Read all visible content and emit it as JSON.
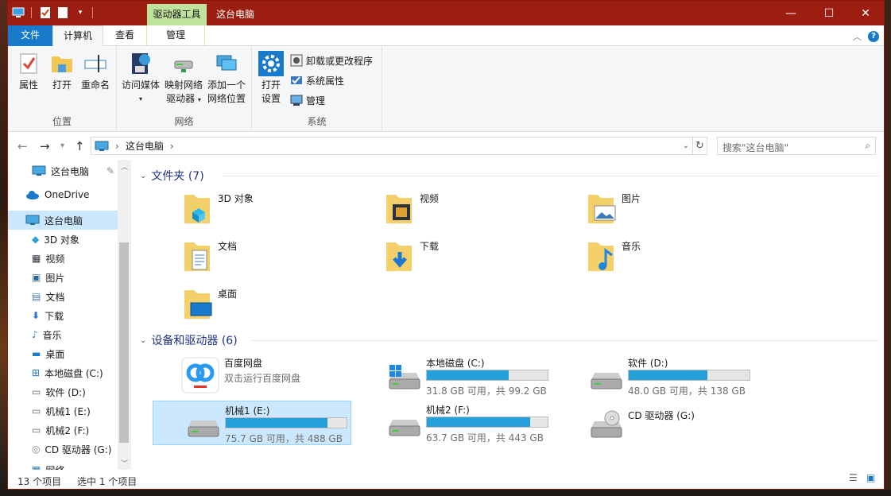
{
  "titlebar": {
    "context_tab": "驱动器工具",
    "title": "这台电脑",
    "minimize": "—",
    "maximize": "☐",
    "close": "✕"
  },
  "tabs": {
    "file": "文件",
    "computer": "计算机",
    "view": "查看",
    "manage": "管理"
  },
  "ribbon": {
    "location": {
      "label": "位置",
      "properties": "属性",
      "open": "打开",
      "rename": "重命名"
    },
    "network": {
      "label": "网络",
      "access_media": "访问媒体",
      "map_drive_1": "映射网络",
      "map_drive_2": "驱动器",
      "add_location_1": "添加一个",
      "add_location_2": "网络位置"
    },
    "system": {
      "label": "系统",
      "open_settings_1": "打开",
      "open_settings_2": "设置",
      "uninstall": "卸载或更改程序",
      "sys_props": "系统属性",
      "manage": "管理"
    }
  },
  "address": {
    "path": "这台电脑",
    "search_placeholder": "搜索\"这台电脑\""
  },
  "nav": {
    "quick": "这台电脑",
    "onedrive": "OneDrive",
    "thispc": "这台电脑",
    "items": [
      "3D 对象",
      "视频",
      "图片",
      "文档",
      "下载",
      "音乐",
      "桌面",
      "本地磁盘 (C:)",
      "软件 (D:)",
      "机械1 (E:)",
      "机械2 (F:)",
      "CD 驱动器 (G:)",
      "网络"
    ]
  },
  "folders": {
    "header": "文件夹 (7)",
    "items": [
      "3D 对象",
      "视频",
      "图片",
      "文档",
      "下载",
      "音乐",
      "桌面"
    ]
  },
  "drives": {
    "header": "设备和驱动器 (6)",
    "items": [
      {
        "name": "百度网盘",
        "sub": "双击运行百度网盘",
        "fill": null
      },
      {
        "name": "本地磁盘 (C:)",
        "sub": "31.8 GB 可用，共 99.2 GB",
        "fill": 0.68
      },
      {
        "name": "软件 (D:)",
        "sub": "48.0 GB 可用，共 138 GB",
        "fill": 0.65
      },
      {
        "name": "机械1 (E:)",
        "sub": "75.7 GB 可用，共 488 GB",
        "fill": 0.845
      },
      {
        "name": "机械2 (F:)",
        "sub": "63.7 GB 可用，共 443 GB",
        "fill": 0.856
      },
      {
        "name": "CD 驱动器 (G:)",
        "sub": "",
        "fill": null
      }
    ]
  },
  "status": {
    "count": "13 个项目",
    "selected": "选中 1 个项目"
  }
}
